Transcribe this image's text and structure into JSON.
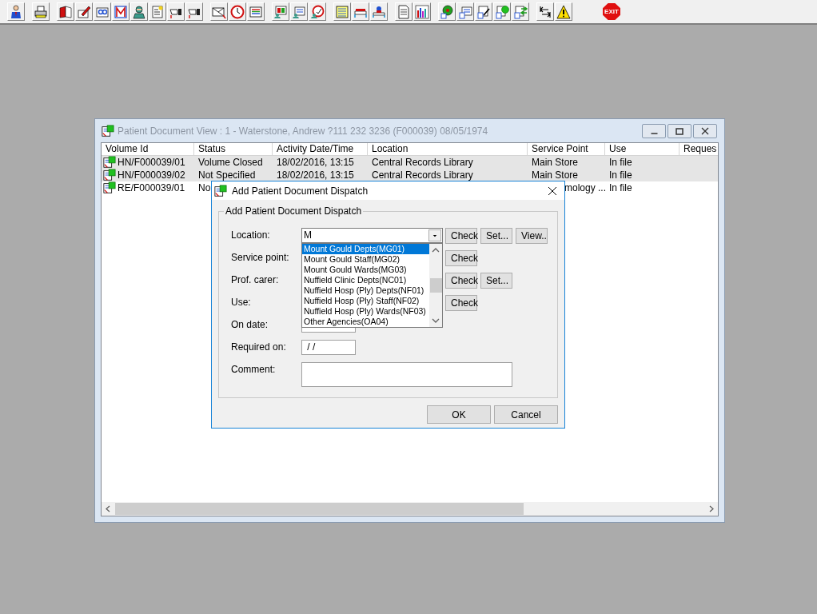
{
  "toolbar": {
    "exit_label": "EXIT"
  },
  "document_window": {
    "title": "Patient Document View : 1 - Waterstone, Andrew ?111 232 3236 (F000039) 08/05/1974",
    "columns": [
      "Volume Id",
      "Status",
      "Activity Date/Time",
      "Location",
      "Service Point",
      "Use",
      "Reques"
    ],
    "rows": [
      {
        "selected": true,
        "cells": [
          "HN/F000039/01",
          "Volume Closed",
          "18/02/2016, 13:15",
          "Central Records Library",
          "Main Store",
          "In file"
        ]
      },
      {
        "selected": true,
        "cells": [
          "HN/F000039/02",
          "Not Specified",
          "18/02/2016, 13:15",
          "Central Records Library",
          "Main Store",
          "In file"
        ]
      },
      {
        "selected": false,
        "cells": [
          "RE/F000039/01",
          "No",
          null,
          null,
          "mology ...",
          "In file"
        ]
      }
    ]
  },
  "dialog": {
    "title": "Add Patient Document Dispatch",
    "group_title": "Add Patient Document Dispatch",
    "fields": [
      {
        "kind": "combo",
        "label": "Location:",
        "value": "M",
        "buttons": [
          "Check",
          "Set...",
          "View.."
        ]
      },
      {
        "kind": "covered",
        "label": "Service point:",
        "buttons": [
          "Check"
        ]
      },
      {
        "kind": "covered",
        "label": "Prof. carer:",
        "buttons": [
          "Check",
          "Set..."
        ]
      },
      {
        "kind": "covered",
        "label": "Use:",
        "buttons": [
          "Check"
        ]
      },
      {
        "kind": "date",
        "label": "On date:"
      },
      {
        "kind": "date",
        "label": "Required on:",
        "value": " / /"
      },
      {
        "kind": "memo",
        "label": "Comment:"
      }
    ],
    "dropdown": [
      {
        "label": "Mount Gould Depts(MG01)",
        "selected": true
      },
      {
        "label": "Mount Gould Staff(MG02)",
        "selected": false
      },
      {
        "label": "Mount Gould Wards(MG03)",
        "selected": false
      },
      {
        "label": "Nuffield Clinic Depts(NC01)",
        "selected": false
      },
      {
        "label": "Nuffield Hosp (Ply) Depts(NF01)",
        "selected": false
      },
      {
        "label": "Nuffield Hosp (Ply) Staff(NF02)",
        "selected": false
      },
      {
        "label": "Nuffield Hosp (Ply) Wards(NF03)",
        "selected": false
      },
      {
        "label": "Other Agencies(OA04)",
        "selected": false
      }
    ],
    "buttons": [
      "OK",
      "Cancel"
    ]
  }
}
